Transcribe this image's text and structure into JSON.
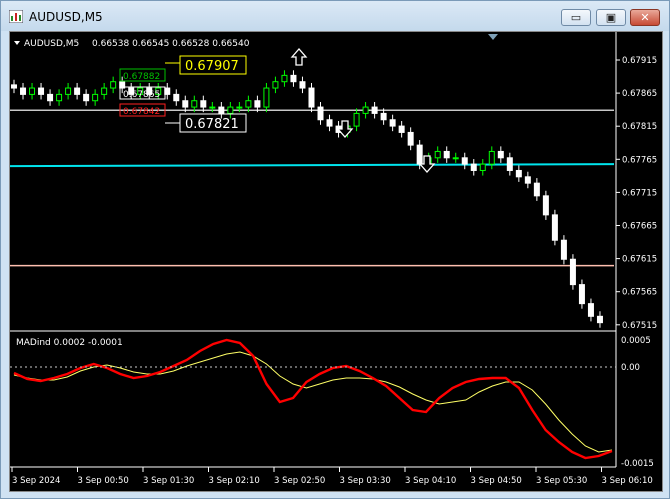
{
  "window": {
    "title": "AUDUSD,M5",
    "buttons": {
      "minimize": "▭",
      "maximize": "▣",
      "close": "✕"
    }
  },
  "chart": {
    "header_symbol": "AUDUSD,M5",
    "header_ohlc": "0.66538 0.66545 0.66528 0.66540",
    "price_axis": [
      "0.67915",
      "0.67865",
      "0.67815",
      "0.67765",
      "0.67715",
      "0.67665",
      "0.67615",
      "0.67565",
      "0.67515"
    ],
    "level_labels": {
      "upper_target": "0.67907",
      "green_box": "0.67882",
      "white_box": "0.67865",
      "red_box": "0.67842",
      "lower_target": "0.67821"
    },
    "colors": {
      "bull_candle": "#00ff00",
      "bear_candle": "#ffffff",
      "support_line": "#c8c8c8",
      "cyan_line": "#00e5ee",
      "salmon_line": "#ffbfb0",
      "red_signal": "#ff0000",
      "yellow_signal": "#ffff66",
      "target_box_yellow": "#ffff00",
      "target_box_white": "#ffffff",
      "green_box": "#00c000",
      "red_box": "#ff2020"
    },
    "icons": {
      "up_arrow": "arrow-up-icon",
      "down_arrow": "arrow-down-icon",
      "menu": "triangle-down-icon"
    }
  },
  "indicator": {
    "label": "MADind 0.0002 -0.0001",
    "axis": [
      "0.0005",
      "0.00",
      "-0.0015"
    ]
  },
  "time_axis": [
    "3 Sep 2024",
    "3 Sep 00:50",
    "3 Sep 01:30",
    "3 Sep 02:10",
    "3 Sep 02:50",
    "3 Sep 03:30",
    "3 Sep 04:10",
    "3 Sep 04:50",
    "3 Sep 05:30",
    "3 Sep 06:10"
  ],
  "chart_data": {
    "type": "candlestick",
    "symbol": "AUDUSD",
    "timeframe": "M5",
    "y_range": [
      0.6751,
      0.6795
    ],
    "horizontal_levels": [
      {
        "value": 0.67855,
        "color": "#c8c8c8"
      },
      {
        "value": 0.6777,
        "color": "#00e5ee"
      },
      {
        "value": 0.6761,
        "color": "#ffbfb0"
      }
    ],
    "candles_close_approx": [
      0.6789,
      0.6788,
      0.6789,
      0.6788,
      0.6787,
      0.6788,
      0.6789,
      0.6788,
      0.6787,
      0.6788,
      0.6789,
      0.679,
      0.6789,
      0.6788,
      0.6789,
      0.6788,
      0.6789,
      0.6788,
      0.6787,
      0.6786,
      0.6787,
      0.6786,
      0.6786,
      0.6785,
      0.6786,
      0.6786,
      0.6787,
      0.6786,
      0.6789,
      0.679,
      0.6791,
      0.679,
      0.6789,
      0.6786,
      0.6784,
      0.6783,
      0.6782,
      0.6783,
      0.6785,
      0.6786,
      0.6785,
      0.6784,
      0.6783,
      0.6782,
      0.678,
      0.6777,
      0.6778,
      0.6779,
      0.6778,
      0.6778,
      0.6777,
      0.6776,
      0.6777,
      0.6779,
      0.6778,
      0.6776,
      0.6775,
      0.6774,
      0.6772,
      0.6769,
      0.6765,
      0.6762,
      0.6758,
      0.6755,
      0.6753,
      0.6752
    ]
  }
}
